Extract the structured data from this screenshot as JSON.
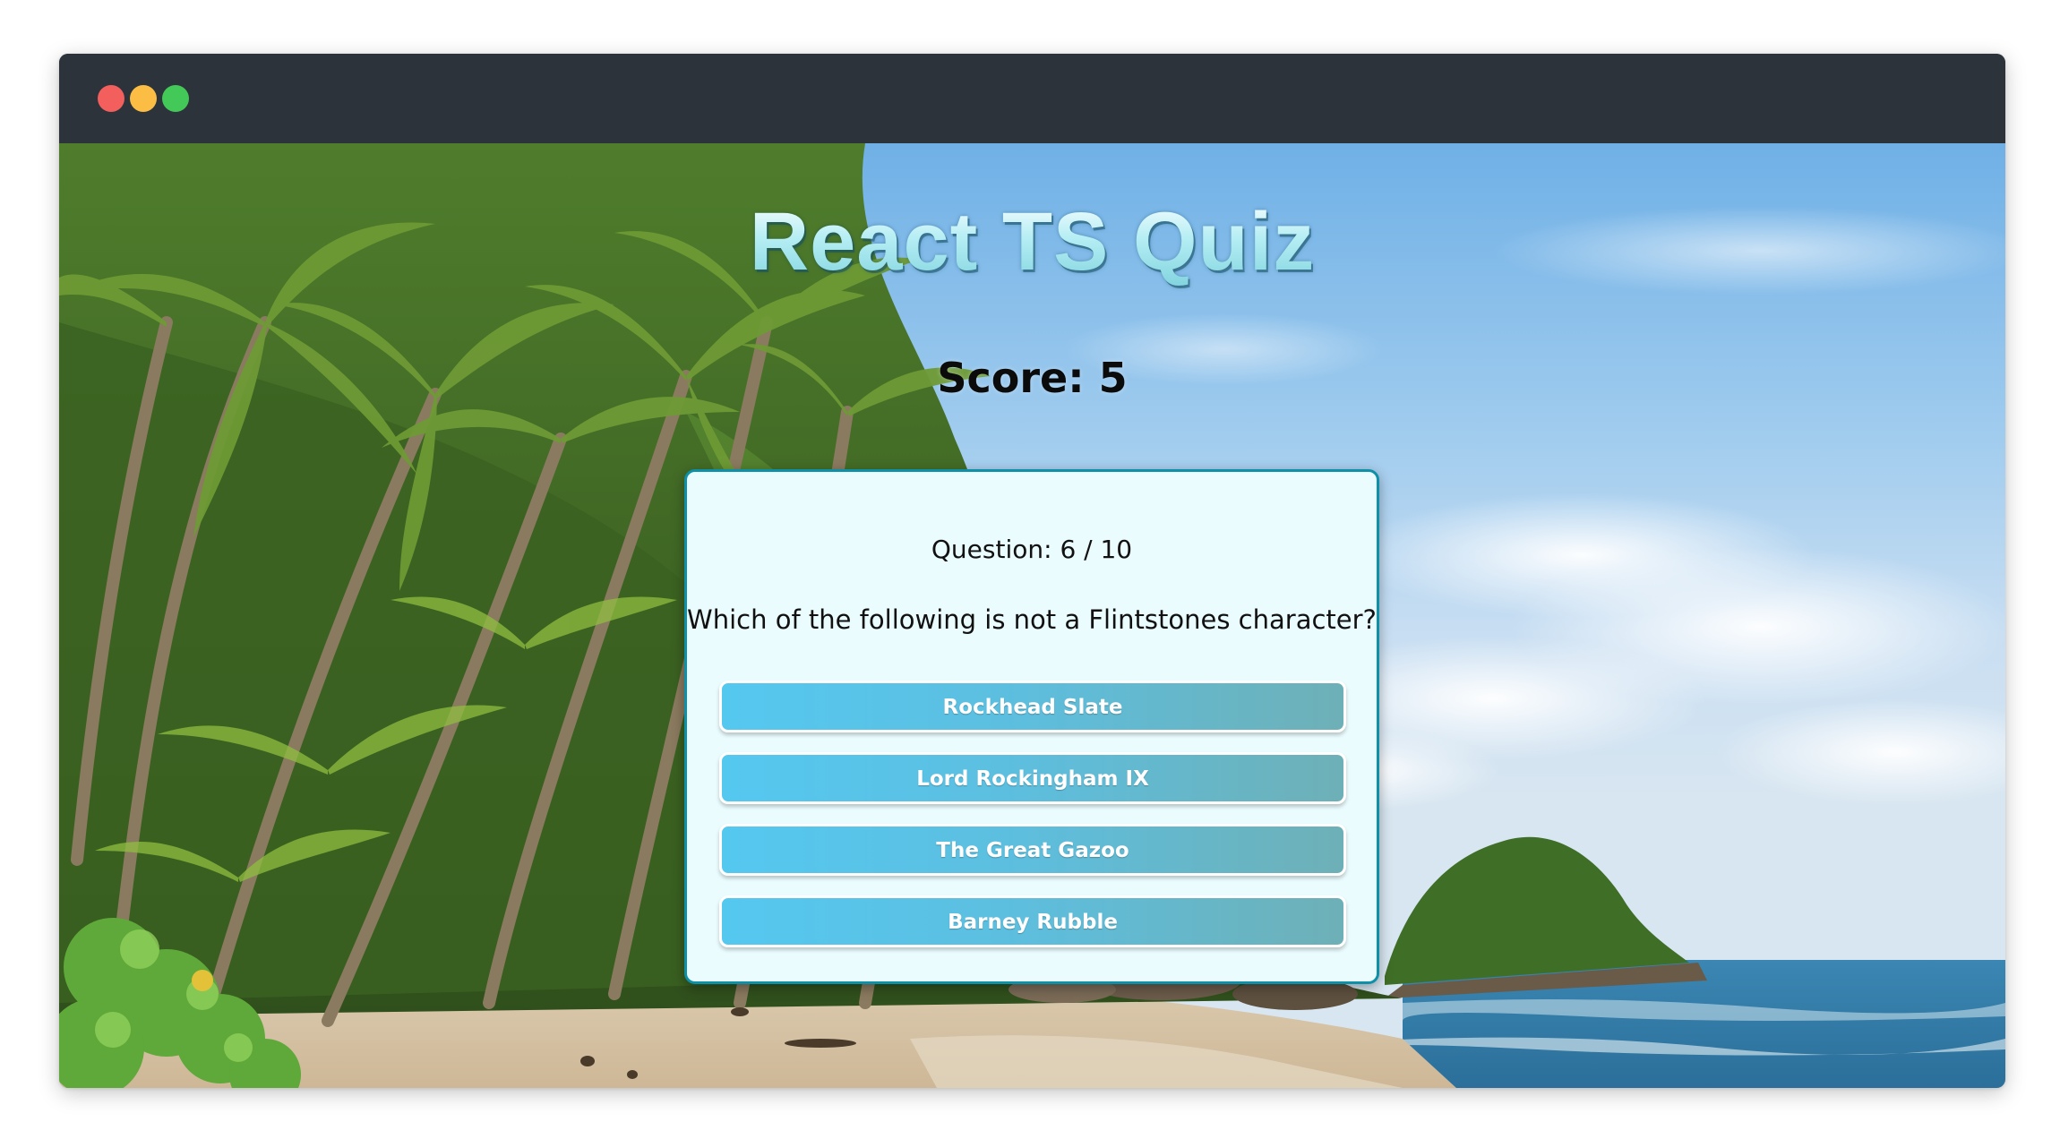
{
  "window": {
    "controls": [
      {
        "name": "close",
        "color": "#f25f5c"
      },
      {
        "name": "minimize",
        "color": "#fbbd43"
      },
      {
        "name": "maximize",
        "color": "#42c957"
      }
    ]
  },
  "app": {
    "title": "React TS Quiz",
    "score_text": "Score: 5"
  },
  "question": {
    "number_text": "Question: 6 / 10",
    "text": "Which of the following is not a Flintstones character?",
    "answers": [
      "Rockhead Slate",
      "Lord Rockingham IX",
      "The Great Gazoo",
      "Barney Rubble"
    ]
  },
  "colors": {
    "card_border": "#0e90a8",
    "card_background": "#ebfcfe",
    "answer_gradient_start": "#55c8f0",
    "answer_gradient_end": "#6eb0b7"
  }
}
